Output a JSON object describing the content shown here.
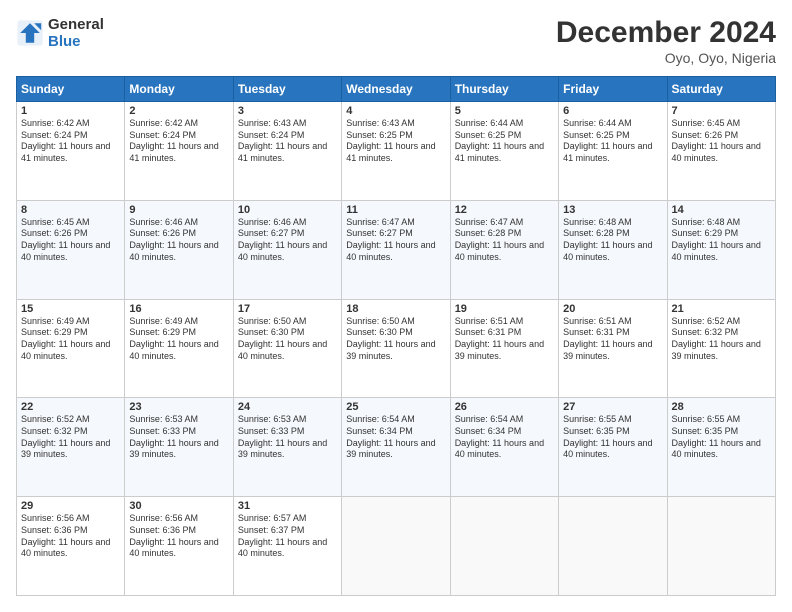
{
  "header": {
    "logo_line1": "General",
    "logo_line2": "Blue",
    "title": "December 2024",
    "subtitle": "Oyo, Oyo, Nigeria"
  },
  "days_of_week": [
    "Sunday",
    "Monday",
    "Tuesday",
    "Wednesday",
    "Thursday",
    "Friday",
    "Saturday"
  ],
  "weeks": [
    [
      {
        "day": "1",
        "rise": "6:42 AM",
        "set": "6:24 PM",
        "daylight": "11 hours and 41 minutes."
      },
      {
        "day": "2",
        "rise": "6:42 AM",
        "set": "6:24 PM",
        "daylight": "11 hours and 41 minutes."
      },
      {
        "day": "3",
        "rise": "6:43 AM",
        "set": "6:24 PM",
        "daylight": "11 hours and 41 minutes."
      },
      {
        "day": "4",
        "rise": "6:43 AM",
        "set": "6:25 PM",
        "daylight": "11 hours and 41 minutes."
      },
      {
        "day": "5",
        "rise": "6:44 AM",
        "set": "6:25 PM",
        "daylight": "11 hours and 41 minutes."
      },
      {
        "day": "6",
        "rise": "6:44 AM",
        "set": "6:25 PM",
        "daylight": "11 hours and 41 minutes."
      },
      {
        "day": "7",
        "rise": "6:45 AM",
        "set": "6:26 PM",
        "daylight": "11 hours and 40 minutes."
      }
    ],
    [
      {
        "day": "8",
        "rise": "6:45 AM",
        "set": "6:26 PM",
        "daylight": "11 hours and 40 minutes."
      },
      {
        "day": "9",
        "rise": "6:46 AM",
        "set": "6:26 PM",
        "daylight": "11 hours and 40 minutes."
      },
      {
        "day": "10",
        "rise": "6:46 AM",
        "set": "6:27 PM",
        "daylight": "11 hours and 40 minutes."
      },
      {
        "day": "11",
        "rise": "6:47 AM",
        "set": "6:27 PM",
        "daylight": "11 hours and 40 minutes."
      },
      {
        "day": "12",
        "rise": "6:47 AM",
        "set": "6:28 PM",
        "daylight": "11 hours and 40 minutes."
      },
      {
        "day": "13",
        "rise": "6:48 AM",
        "set": "6:28 PM",
        "daylight": "11 hours and 40 minutes."
      },
      {
        "day": "14",
        "rise": "6:48 AM",
        "set": "6:29 PM",
        "daylight": "11 hours and 40 minutes."
      }
    ],
    [
      {
        "day": "15",
        "rise": "6:49 AM",
        "set": "6:29 PM",
        "daylight": "11 hours and 40 minutes."
      },
      {
        "day": "16",
        "rise": "6:49 AM",
        "set": "6:29 PM",
        "daylight": "11 hours and 40 minutes."
      },
      {
        "day": "17",
        "rise": "6:50 AM",
        "set": "6:30 PM",
        "daylight": "11 hours and 40 minutes."
      },
      {
        "day": "18",
        "rise": "6:50 AM",
        "set": "6:30 PM",
        "daylight": "11 hours and 39 minutes."
      },
      {
        "day": "19",
        "rise": "6:51 AM",
        "set": "6:31 PM",
        "daylight": "11 hours and 39 minutes."
      },
      {
        "day": "20",
        "rise": "6:51 AM",
        "set": "6:31 PM",
        "daylight": "11 hours and 39 minutes."
      },
      {
        "day": "21",
        "rise": "6:52 AM",
        "set": "6:32 PM",
        "daylight": "11 hours and 39 minutes."
      }
    ],
    [
      {
        "day": "22",
        "rise": "6:52 AM",
        "set": "6:32 PM",
        "daylight": "11 hours and 39 minutes."
      },
      {
        "day": "23",
        "rise": "6:53 AM",
        "set": "6:33 PM",
        "daylight": "11 hours and 39 minutes."
      },
      {
        "day": "24",
        "rise": "6:53 AM",
        "set": "6:33 PM",
        "daylight": "11 hours and 39 minutes."
      },
      {
        "day": "25",
        "rise": "6:54 AM",
        "set": "6:34 PM",
        "daylight": "11 hours and 39 minutes."
      },
      {
        "day": "26",
        "rise": "6:54 AM",
        "set": "6:34 PM",
        "daylight": "11 hours and 40 minutes."
      },
      {
        "day": "27",
        "rise": "6:55 AM",
        "set": "6:35 PM",
        "daylight": "11 hours and 40 minutes."
      },
      {
        "day": "28",
        "rise": "6:55 AM",
        "set": "6:35 PM",
        "daylight": "11 hours and 40 minutes."
      }
    ],
    [
      {
        "day": "29",
        "rise": "6:56 AM",
        "set": "6:36 PM",
        "daylight": "11 hours and 40 minutes."
      },
      {
        "day": "30",
        "rise": "6:56 AM",
        "set": "6:36 PM",
        "daylight": "11 hours and 40 minutes."
      },
      {
        "day": "31",
        "rise": "6:57 AM",
        "set": "6:37 PM",
        "daylight": "11 hours and 40 minutes."
      },
      null,
      null,
      null,
      null
    ]
  ]
}
